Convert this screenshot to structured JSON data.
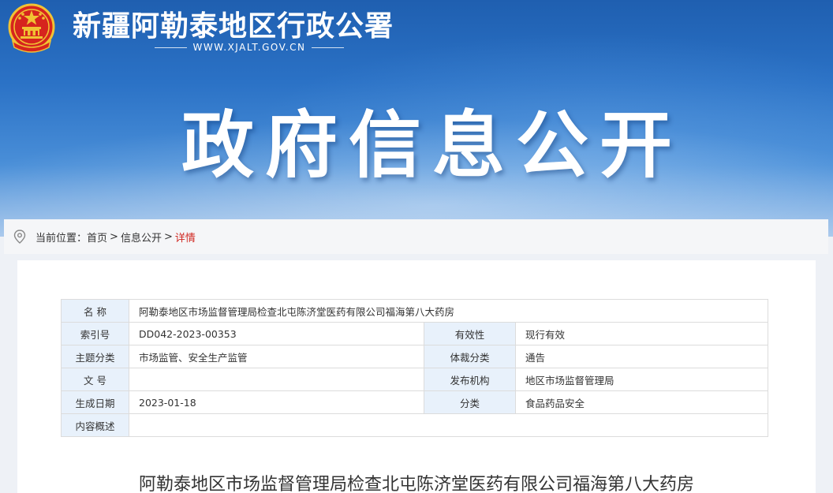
{
  "header": {
    "site_title": "新疆阿勒泰地区行政公署",
    "site_url": "WWW.XJALT.GOV.CN",
    "banner_title": "政府信息公开",
    "colors": {
      "banner": "#2b72c6",
      "label_bg": "#e8f1fb",
      "breadcrumb_current": "#d0261f"
    }
  },
  "breadcrumb": {
    "prefix": "当前位置：",
    "home": "首页",
    "section": "信息公开",
    "current": "详情",
    "separator": ">"
  },
  "meta": {
    "name_label": "名 称",
    "name_value": "阿勒泰地区市场监督管理局检查北屯陈济堂医药有限公司福海第八大药房",
    "index_label": "索引号",
    "index_value": "DD042-2023-00353",
    "validity_label": "有效性",
    "validity_value": "现行有效",
    "topic_label": "主题分类",
    "topic_value": "市场监管、安全生产监管",
    "genre_label": "体裁分类",
    "genre_value": "通告",
    "docno_label": "文 号",
    "docno_value": "",
    "publisher_label": "发布机构",
    "publisher_value": "地区市场监督管理局",
    "date_label": "生成日期",
    "date_value": "2023-01-18",
    "category_label": "分类",
    "category_value": "食品药品安全",
    "summary_label": "内容概述",
    "summary_value": ""
  },
  "article": {
    "title": "阿勒泰地区市场监督管理局检查北屯陈济堂医药有限公司福海第八大药房"
  }
}
